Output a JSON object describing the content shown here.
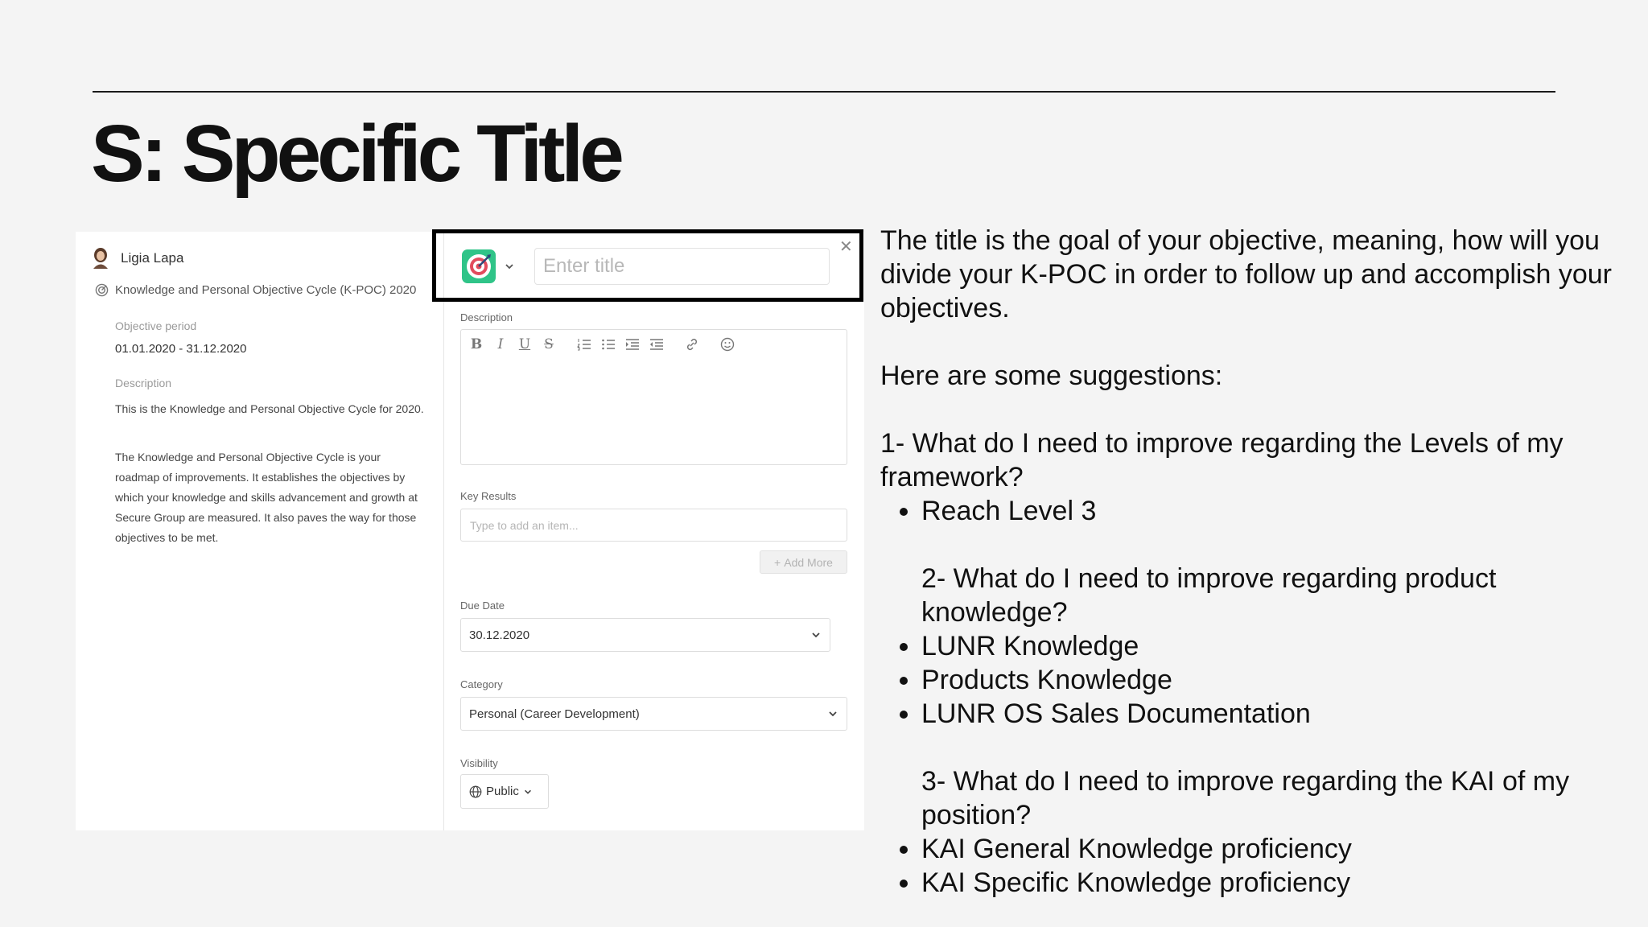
{
  "slide": {
    "title": "S: Specific Title"
  },
  "left_panel": {
    "user_name": "Ligia Lapa",
    "cycle_name": "Knowledge and Personal Objective Cycle (K-POC) 2020",
    "period_label": "Objective period",
    "period_value": "01.01.2020 - 31.12.2020",
    "description_label": "Description",
    "description_p1": "This is the Knowledge and Personal Objective Cycle for 2020.",
    "description_p2": "The Knowledge and Personal Objective Cycle is your roadmap of improvements. It establishes the objectives by which your knowledge and skills advancement and growth at Secure Group are measured. It also paves the way for those objectives to be met."
  },
  "form": {
    "title_placeholder": "Enter title",
    "description_label": "Description",
    "key_results_label": "Key Results",
    "key_results_placeholder": "Type to add an item...",
    "add_more_label": "Add More",
    "due_date_label": "Due Date",
    "due_date_value": "30.12.2020",
    "category_label": "Category",
    "category_value": "Personal (Career Development)",
    "visibility_label": "Visibility",
    "visibility_value": "Public",
    "toolbar_icons": [
      "bold-icon",
      "italic-icon",
      "underline-icon",
      "strikethrough-icon",
      "ordered-list-icon",
      "bullet-list-icon",
      "indent-icon",
      "outdent-icon",
      "link-icon",
      "emoji-icon"
    ],
    "accent_color": "#2fc488"
  },
  "explanation": {
    "intro": "The title is the goal of your objective, meaning, how will you divide your K-POC in order to follow up and accomplish your objectives.",
    "suggestions_heading": "Here are some suggestions:",
    "q1": "1- What do I need to improve regarding the Levels of my framework?",
    "q1_items": [
      "Reach Level 3"
    ],
    "q2": "2- What do I need to improve regarding product knowledge?",
    "q2_items": [
      "LUNR Knowledge",
      "Products Knowledge",
      "LUNR OS Sales Documentation"
    ],
    "q3": "3- What do I need to improve regarding the KAI of my position?",
    "q3_items": [
      "KAI General Knowledge proficiency",
      "KAI Specific Knowledge proficiency"
    ]
  }
}
